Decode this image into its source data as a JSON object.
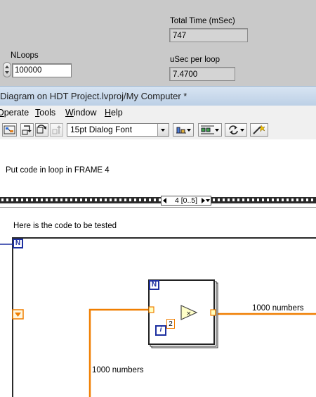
{
  "front_panel": {
    "total_time_label": "Total Time (mSec)",
    "total_time_value": "747",
    "nloops_label": "NLoops",
    "nloops_value": "100000",
    "usec_label": "uSec per loop",
    "usec_value": "7.4700"
  },
  "window": {
    "title": "Diagram on HDT Project.lvproj/My Computer *"
  },
  "menu": {
    "items": [
      {
        "label": "Operate",
        "hotkey": "O"
      },
      {
        "label": "Tools",
        "hotkey": "T"
      },
      {
        "label": "Window",
        "hotkey": "W"
      },
      {
        "label": "Help",
        "hotkey": "H"
      }
    ]
  },
  "toolbar": {
    "font": "15pt Dialog Font"
  },
  "diagram": {
    "comment": "Put code in loop in FRAME 4",
    "frame_selector": "4 [0..5]",
    "code_label": "Here is the code to be tested",
    "outer_loop_count": "N",
    "inner_loop_count": "N",
    "iteration_terminal": "i",
    "constant": "2",
    "wire_label_right": "1000 numbers",
    "wire_label_bottom": "1000 numbers"
  },
  "colors": {
    "wire_numeric": "#f07e00",
    "loop_terminal": "#1d2fa0",
    "multiply_node": "#ffffc8"
  }
}
